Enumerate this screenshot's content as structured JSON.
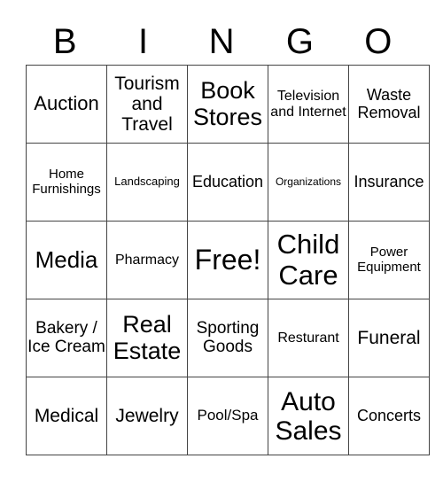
{
  "header": [
    "B",
    "I",
    "N",
    "G",
    "O"
  ],
  "rows": [
    [
      {
        "text": "Auction",
        "size": 22
      },
      {
        "text": "Tourism and Travel",
        "size": 21
      },
      {
        "text": "Book Stores",
        "size": 27
      },
      {
        "text": "Television and Internet",
        "size": 16
      },
      {
        "text": "Waste Removal",
        "size": 18
      }
    ],
    [
      {
        "text": "Home Furnishings",
        "size": 15
      },
      {
        "text": "Landscaping",
        "size": 13
      },
      {
        "text": "Education",
        "size": 18
      },
      {
        "text": "Organizations",
        "size": 12
      },
      {
        "text": "Insurance",
        "size": 18
      }
    ],
    [
      {
        "text": "Media",
        "size": 26
      },
      {
        "text": "Pharmacy",
        "size": 16
      },
      {
        "text": "Free!",
        "size": 32
      },
      {
        "text": "Child Care",
        "size": 31
      },
      {
        "text": "Power Equipment",
        "size": 15
      }
    ],
    [
      {
        "text": "Bakery / Ice Cream",
        "size": 19
      },
      {
        "text": "Real Estate",
        "size": 27
      },
      {
        "text": "Sporting Goods",
        "size": 19
      },
      {
        "text": "Resturant",
        "size": 16
      },
      {
        "text": "Funeral",
        "size": 21
      }
    ],
    [
      {
        "text": "Medical",
        "size": 21
      },
      {
        "text": "Jewelry",
        "size": 21
      },
      {
        "text": "Pool/Spa",
        "size": 17
      },
      {
        "text": "Auto Sales",
        "size": 30
      },
      {
        "text": "Concerts",
        "size": 18
      }
    ]
  ]
}
